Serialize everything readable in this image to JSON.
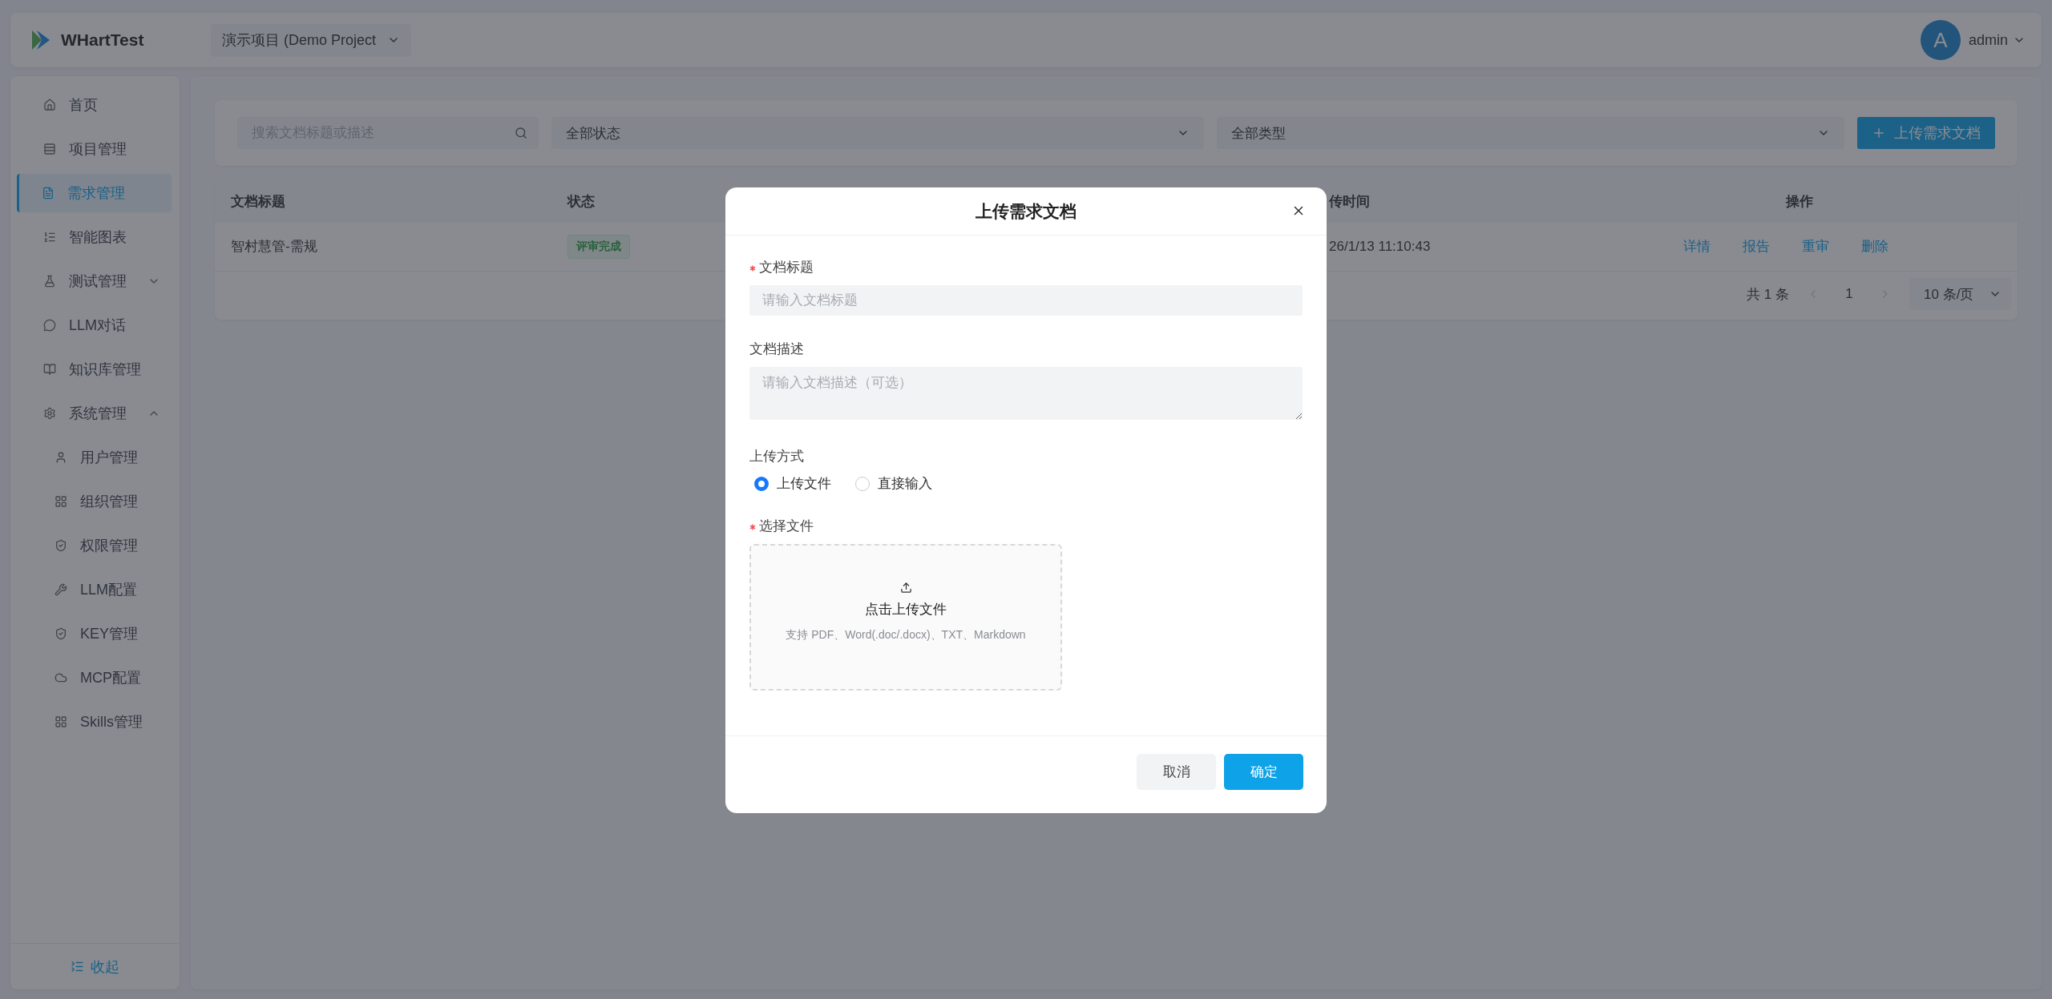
{
  "header": {
    "app_name": "WHartTest",
    "project": "演示项目 (Demo Project",
    "user": {
      "avatar": "A",
      "name": "admin"
    }
  },
  "sidebar": {
    "items": [
      {
        "kind": "link",
        "label": "首页",
        "selected": false
      },
      {
        "kind": "link",
        "label": "项目管理",
        "selected": false
      },
      {
        "kind": "link",
        "label": "需求管理",
        "selected": true
      },
      {
        "kind": "link",
        "label": "智能图表",
        "selected": false
      },
      {
        "kind": "group",
        "label": "测试管理",
        "expanded": false
      },
      {
        "kind": "link",
        "label": "LLM对话",
        "selected": false
      },
      {
        "kind": "link",
        "label": "知识库管理",
        "selected": false
      },
      {
        "kind": "group",
        "label": "系统管理",
        "expanded": true,
        "children": [
          {
            "label": "用户管理",
            "selected": false
          },
          {
            "label": "组织管理",
            "selected": false
          },
          {
            "label": "权限管理",
            "selected": false
          },
          {
            "label": "LLM配置",
            "selected": false
          },
          {
            "label": "KEY管理",
            "selected": false
          },
          {
            "label": "MCP配置",
            "selected": false
          },
          {
            "label": "Skills管理",
            "selected": false
          }
        ]
      }
    ],
    "collapse": "收起"
  },
  "filters": {
    "search": {
      "placeholder": "搜索文档标题或描述"
    },
    "status": "全部状态",
    "type": "全部类型",
    "upload_button": "上传需求文档"
  },
  "table": {
    "columns": [
      "文档标题",
      "状态",
      "传时间",
      "操作"
    ],
    "rows": [
      {
        "title": "智村慧管-需规",
        "status": "评审完成",
        "column_3": "26/1/13 11:10:43",
        "actions": [
          "详情",
          "报告",
          "重审",
          "删除"
        ]
      }
    ]
  },
  "pagination": {
    "total": "共 1 条",
    "pages": [
      {
        "label": "1",
        "selected": true
      }
    ],
    "page_size": "10 条/页"
  },
  "modal": {
    "title": "上传需求文档",
    "fields": [
      {
        "kind": "text",
        "label": "文档标题",
        "required": true,
        "placeholder": "请输入文档标题"
      },
      {
        "kind": "textarea",
        "label": "文档描述",
        "required": false,
        "placeholder": "请输入文档描述（可选）"
      },
      {
        "kind": "radio",
        "label": "上传方式",
        "required": false,
        "options": [
          {
            "label": "上传文件",
            "selected": true
          },
          {
            "label": "直接输入",
            "selected": false
          }
        ]
      },
      {
        "kind": "upload",
        "label": "选择文件",
        "required": true,
        "title": "点击上传文件",
        "hint": "支持 PDF、Word(.doc/.docx)、TXT、Markdown"
      }
    ],
    "buttons": [
      {
        "kind": "secondary",
        "label": "取消"
      },
      {
        "kind": "primary",
        "label": "确定"
      }
    ]
  }
}
